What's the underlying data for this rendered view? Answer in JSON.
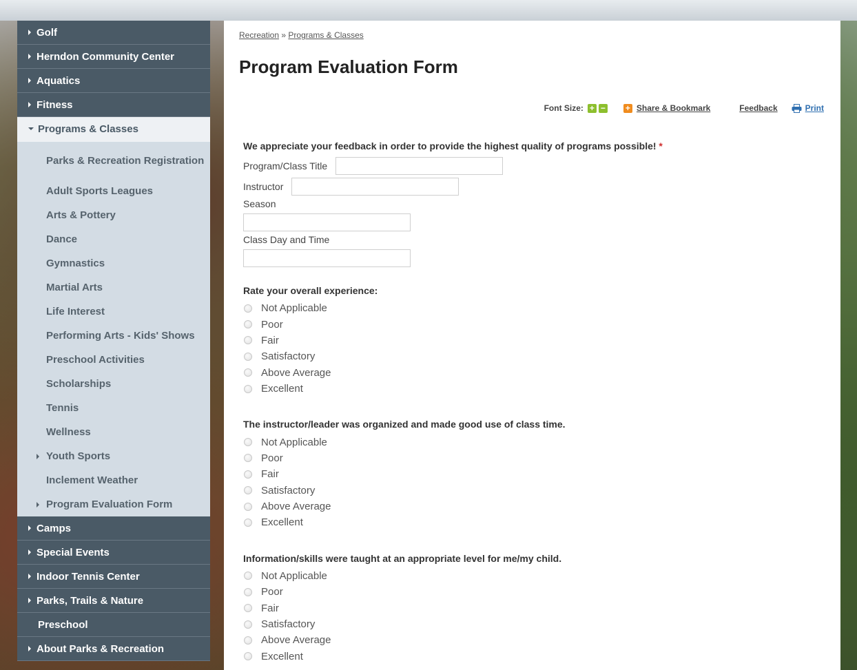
{
  "sidebar": {
    "top_items_before": [
      {
        "label": "Golf"
      },
      {
        "label": "Herndon Community Center"
      },
      {
        "label": "Aquatics"
      },
      {
        "label": "Fitness"
      }
    ],
    "open_item": {
      "label": "Programs & Classes"
    },
    "sub_items": [
      {
        "label": "Parks & Recreation Registration",
        "caret": false
      },
      {
        "label": "Adult Sports Leagues",
        "caret": false
      },
      {
        "label": "Arts & Pottery",
        "caret": false
      },
      {
        "label": "Dance",
        "caret": false
      },
      {
        "label": "Gymnastics",
        "caret": false
      },
      {
        "label": "Martial Arts",
        "caret": false
      },
      {
        "label": "Life Interest",
        "caret": false
      },
      {
        "label": "Performing Arts - Kids' Shows",
        "caret": false
      },
      {
        "label": "Preschool Activities",
        "caret": false
      },
      {
        "label": "Scholarships",
        "caret": false
      },
      {
        "label": "Tennis",
        "caret": false
      },
      {
        "label": "Wellness",
        "caret": false
      },
      {
        "label": "Youth Sports",
        "caret": true
      },
      {
        "label": "Inclement Weather",
        "caret": false
      },
      {
        "label": "Program Evaluation Form",
        "caret": true
      }
    ],
    "top_items_after": [
      {
        "label": "Camps",
        "caret": true
      },
      {
        "label": "Special Events",
        "caret": true
      },
      {
        "label": "Indoor Tennis Center",
        "caret": true
      },
      {
        "label": "Parks, Trails & Nature",
        "caret": true
      },
      {
        "label": "Preschool",
        "caret": false
      },
      {
        "label": "About Parks & Recreation",
        "caret": true
      }
    ]
  },
  "breadcrumb": {
    "item1": "Recreation",
    "separator": "»",
    "item2": "Programs & Classes"
  },
  "page_title": "Program Evaluation Form",
  "tools": {
    "font_size_label": "Font Size:",
    "plus": "+",
    "minus": "−",
    "share_plus": "+",
    "share_label": "Share & Bookmark",
    "feedback_label": "Feedback",
    "print_label": "Print"
  },
  "form": {
    "intro": "We appreciate your feedback in order to provide the highest quality of programs possible!",
    "required_mark": "*",
    "program_title_label": "Program/Class Title",
    "program_title_value": "",
    "instructor_label": "Instructor",
    "instructor_value": "",
    "season_label": "Season",
    "season_value": "",
    "class_day_label": "Class Day and Time",
    "class_day_value": "",
    "questions": [
      {
        "text": "Rate your overall experience:",
        "options": [
          "Not Applicable",
          "Poor",
          "Fair",
          "Satisfactory",
          "Above Average",
          "Excellent"
        ]
      },
      {
        "text": "The instructor/leader was organized and made good use of class time.",
        "options": [
          "Not Applicable",
          "Poor",
          "Fair",
          "Satisfactory",
          "Above Average",
          "Excellent"
        ]
      },
      {
        "text": "Information/skills were taught at an appropriate level for me/my child.",
        "options": [
          "Not Applicable",
          "Poor",
          "Fair",
          "Satisfactory",
          "Above Average",
          "Excellent"
        ]
      }
    ]
  },
  "colors": {
    "nav_dark": "#4a5a66",
    "nav_sub": "#d3dce4",
    "accent_green": "#8dbf2e",
    "accent_orange": "#f08c1e",
    "print_blue": "#2f6fb0",
    "required_red": "#d03030"
  }
}
